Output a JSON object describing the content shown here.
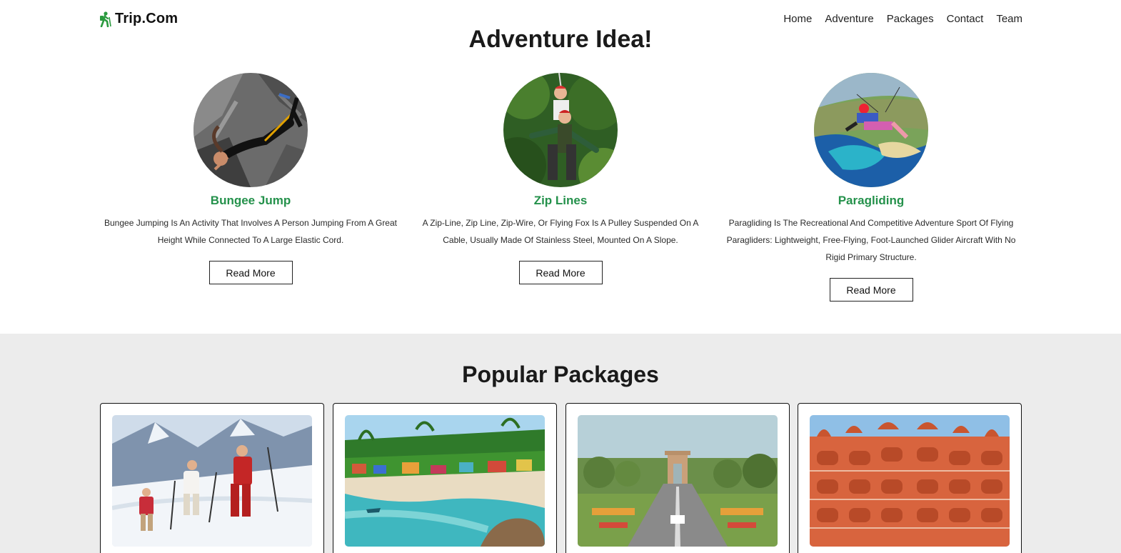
{
  "header": {
    "brand": "Trip.Com",
    "nav": [
      "Home",
      "Adventure",
      "Packages",
      "Contact",
      "Team"
    ]
  },
  "adventure": {
    "title": "Adventure Idea!",
    "cards": [
      {
        "name": "Bungee Jump",
        "description": "Bungee Jumping Is An Activity That Involves A Person Jumping From A Great Height While Connected To A Large Elastic Cord.",
        "button": "Read More"
      },
      {
        "name": "Zip Lines",
        "description": "A Zip-Line, Zip Line, Zip-Wire, Or Flying Fox Is A Pulley Suspended On A Cable, Usually Made Of Stainless Steel, Mounted On A Slope.",
        "button": "Read More"
      },
      {
        "name": "Paragliding",
        "description": "Paragliding Is The Recreational And Competitive Adventure Sport Of Flying Paragliders: Lightweight, Free-Flying, Foot-Launched Glider Aircraft With No Rigid Primary Structure.",
        "button": "Read More"
      }
    ]
  },
  "packages": {
    "title": "Popular Packages"
  },
  "colors": {
    "accent_green": "#24914b",
    "packages_bg": "#ececec"
  }
}
